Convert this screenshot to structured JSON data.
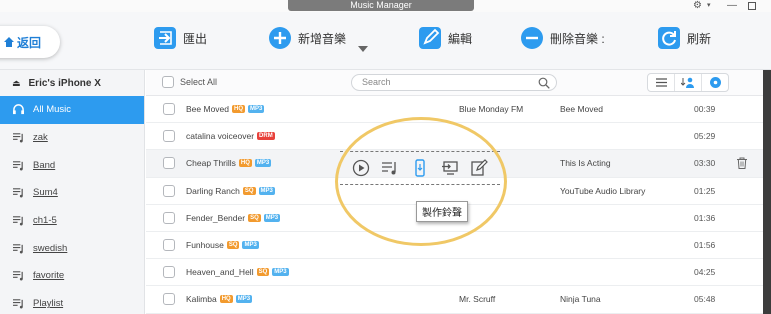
{
  "window": {
    "title": "Music Manager"
  },
  "toolbar": {
    "back": "返回",
    "export": "匯出",
    "add": "新增音樂",
    "edit": "編輯",
    "delete": "刪除音樂 :",
    "refresh": "刷新"
  },
  "sidebar": {
    "device": "Eric's iPhone X",
    "items": [
      {
        "label": "All Music"
      },
      {
        "label": "zak"
      },
      {
        "label": "Band"
      },
      {
        "label": "Sum4"
      },
      {
        "label": "ch1-5"
      },
      {
        "label": "swedish"
      },
      {
        "label": "favorite"
      },
      {
        "label": "Playlist"
      }
    ]
  },
  "list": {
    "select_all": "Select All",
    "search_placeholder": "Search",
    "tooltip": "製作鈴聲",
    "rows": [
      {
        "title": "Bee Moved",
        "b1": "HQ",
        "b2": "MP3",
        "artist": "Blue Monday FM",
        "album": "Bee Moved",
        "time": "00:39"
      },
      {
        "title": "catalina voiceover",
        "b1": "DRM",
        "b2": "",
        "artist": "",
        "album": "",
        "time": "05:29"
      },
      {
        "title": "Cheap Thrills",
        "b1": "HQ",
        "b2": "MP3",
        "artist": "",
        "album": "This Is Acting",
        "time": "03:30"
      },
      {
        "title": "Darling Ranch",
        "b1": "SQ",
        "b2": "MP3",
        "artist": "",
        "album": "YouTube Audio Library",
        "time": "01:25"
      },
      {
        "title": "Fender_Bender",
        "b1": "SQ",
        "b2": "MP3",
        "artist": "",
        "album": "",
        "time": "01:36"
      },
      {
        "title": "Funhouse",
        "b1": "SQ",
        "b2": "MP3",
        "artist": "",
        "album": "",
        "time": "01:56"
      },
      {
        "title": "Heaven_and_Hell",
        "b1": "SQ",
        "b2": "MP3",
        "artist": "",
        "album": "",
        "time": "04:25"
      },
      {
        "title": "Kalimba",
        "b1": "HQ",
        "b2": "MP3",
        "artist": "Mr. Scruff",
        "album": "Ninja Tuna",
        "time": "05:48"
      }
    ]
  },
  "colors": {
    "accent": "#2d9bef",
    "ring": "#f0c866",
    "hq": "#f29a2e",
    "format": "#53b2ef",
    "drm": "#e8413b"
  }
}
